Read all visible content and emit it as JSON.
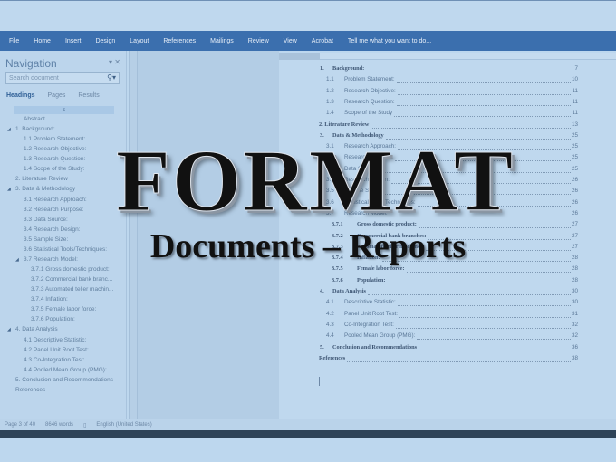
{
  "ribbon": {
    "tabs": [
      "File",
      "Home",
      "Insert",
      "Design",
      "Layout",
      "References",
      "Mailings",
      "Review",
      "View",
      "Acrobat"
    ],
    "tell_me": "Tell me what you want to do..."
  },
  "nav": {
    "title": "Navigation",
    "search_placeholder": "Search document",
    "tabs": [
      "Headings",
      "Pages",
      "Results"
    ],
    "items": [
      {
        "label": "Abstract",
        "level": 1,
        "tri": false
      },
      {
        "label": "1.  Background:",
        "level": 0,
        "tri": true
      },
      {
        "label": "1.1 Problem Statement:",
        "level": 1,
        "tri": false
      },
      {
        "label": "1.2 Research Objective:",
        "level": 1,
        "tri": false
      },
      {
        "label": "1.3 Research Question:",
        "level": 1,
        "tri": false
      },
      {
        "label": "1.4 Scope of the Study:",
        "level": 1,
        "tri": false
      },
      {
        "label": "2. Literature Review",
        "level": 0,
        "tri": false
      },
      {
        "label": "3. Data & Methodology",
        "level": 0,
        "tri": true
      },
      {
        "label": "3.1 Research Approach:",
        "level": 1,
        "tri": false
      },
      {
        "label": "3.2 Research Purpose:",
        "level": 1,
        "tri": false
      },
      {
        "label": "3.3 Data Source:",
        "level": 1,
        "tri": false
      },
      {
        "label": "3.4 Research Design:",
        "level": 1,
        "tri": false
      },
      {
        "label": "3.5 Sample Size:",
        "level": 1,
        "tri": false
      },
      {
        "label": "3.6 Statistical Tools/Techniques:",
        "level": 1,
        "tri": false
      },
      {
        "label": "3.7 Research Model:",
        "level": 1,
        "tri": true
      },
      {
        "label": "3.7.1 Gross domestic product:",
        "level": 2,
        "tri": false
      },
      {
        "label": "3.7.2 Commercial bank branc...",
        "level": 2,
        "tri": false
      },
      {
        "label": "3.7.3 Automated teller machin...",
        "level": 2,
        "tri": false
      },
      {
        "label": "3.7.4 Inflation:",
        "level": 2,
        "tri": false
      },
      {
        "label": "3.7.5 Female labor force:",
        "level": 2,
        "tri": false
      },
      {
        "label": "3.7.6 Population:",
        "level": 2,
        "tri": false
      },
      {
        "label": "4. Data Analysis",
        "level": 0,
        "tri": true
      },
      {
        "label": "4.1 Descriptive Statistic:",
        "level": 1,
        "tri": false
      },
      {
        "label": "4.2 Panel Unit Root Test:",
        "level": 1,
        "tri": false
      },
      {
        "label": "4.3 Co-Integration Test:",
        "level": 1,
        "tri": false
      },
      {
        "label": "4.4 Pooled Mean Group (PMG):",
        "level": 1,
        "tri": false
      },
      {
        "label": "5.  Conclusion and Recommendations",
        "level": 0,
        "tri": false
      },
      {
        "label": "References",
        "level": 0,
        "tri": false
      }
    ]
  },
  "toc": [
    {
      "num": "1.",
      "text": "Background:",
      "page": "7",
      "level": 1,
      "bold": true
    },
    {
      "num": "1.1",
      "text": "Problem Statement:",
      "page": "10",
      "level": 2,
      "bold": false
    },
    {
      "num": "1.2",
      "text": "Research Objective:",
      "page": "11",
      "level": 2,
      "bold": false
    },
    {
      "num": "1.3",
      "text": "Research Question:",
      "page": "11",
      "level": 2,
      "bold": false
    },
    {
      "num": "1.4",
      "text": "Scope of the Study",
      "page": "11",
      "level": 2,
      "bold": false
    },
    {
      "num": "",
      "text": "2. Literature Review",
      "page": "13",
      "level": 0,
      "bold": true
    },
    {
      "num": "3.",
      "text": "Data & Methodology",
      "page": "25",
      "level": 1,
      "bold": true
    },
    {
      "num": "3.1",
      "text": "Research Approach:",
      "page": "25",
      "level": 2,
      "bold": false
    },
    {
      "num": "3.2",
      "text": "Research Purpose:",
      "page": "25",
      "level": 2,
      "bold": false
    },
    {
      "num": "3.3",
      "text": "Data Source:",
      "page": "25",
      "level": 2,
      "bold": false
    },
    {
      "num": "3.4",
      "text": "Research Design:",
      "page": "26",
      "level": 2,
      "bold": false
    },
    {
      "num": "3.5",
      "text": "Sample Size:",
      "page": "26",
      "level": 2,
      "bold": false
    },
    {
      "num": "3.6",
      "text": "Statistical Tools/Techniques:",
      "page": "26",
      "level": 2,
      "bold": false
    },
    {
      "num": "3.7",
      "text": "Research Model:",
      "page": "26",
      "level": 2,
      "bold": false
    },
    {
      "num": "3.7.1",
      "text": "Gross domestic product:",
      "page": "27",
      "level": 3,
      "bold": true
    },
    {
      "num": "3.7.2",
      "text": "Commercial bank branches:",
      "page": "27",
      "level": 3,
      "bold": true
    },
    {
      "num": "3.7.3",
      "text": "Automated teller machines:",
      "page": "27",
      "level": 3,
      "bold": true
    },
    {
      "num": "3.7.4",
      "text": "Inflation:",
      "page": "28",
      "level": 3,
      "bold": true
    },
    {
      "num": "3.7.5",
      "text": "Female labor force:",
      "page": "28",
      "level": 3,
      "bold": true
    },
    {
      "num": "3.7.6",
      "text": "Population:",
      "page": "28",
      "level": 3,
      "bold": true
    },
    {
      "num": "4.",
      "text": "Data Analysis",
      "page": "30",
      "level": 1,
      "bold": true
    },
    {
      "num": "4.1",
      "text": "Descriptive Statistic:",
      "page": "30",
      "level": 2,
      "bold": false
    },
    {
      "num": "4.2",
      "text": "Panel Unit Root Test:",
      "page": "31",
      "level": 2,
      "bold": false
    },
    {
      "num": "4.3",
      "text": "Co-Integration Test:",
      "page": "32",
      "level": 2,
      "bold": false
    },
    {
      "num": "4.4",
      "text": "Pooled Mean Group (PMG):",
      "page": "32",
      "level": 2,
      "bold": false
    },
    {
      "num": "5.",
      "text": "Conclusion and Recommendations",
      "page": "36",
      "level": 1,
      "bold": true
    },
    {
      "num": "",
      "text": "References",
      "page": "38",
      "level": 0,
      "bold": true
    }
  ],
  "status": {
    "page": "Page 3 of 40",
    "words": "8646 words",
    "language": "English (United States)"
  },
  "overlay": {
    "title": "FORMAT",
    "subtitle": "Documents – Reports"
  }
}
